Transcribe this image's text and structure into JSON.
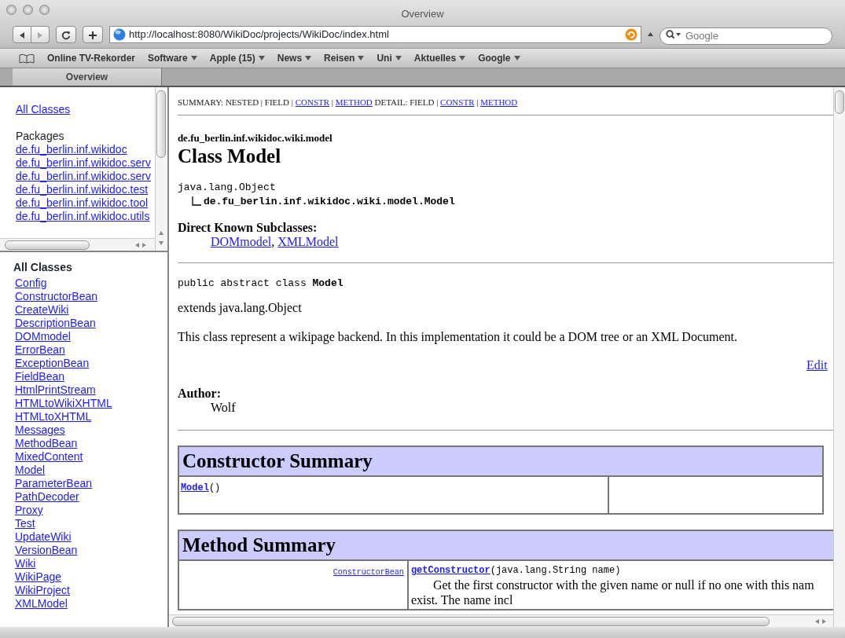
{
  "window": {
    "title": "Overview"
  },
  "toolbar": {
    "url": "http://localhost:8080/WikiDoc/projects/WikiDoc/index.html",
    "search": {
      "placeholder": "Google"
    }
  },
  "bookmarks": [
    {
      "label": "Online TV-Rekorder",
      "has_menu": false
    },
    {
      "label": "Software",
      "has_menu": true
    },
    {
      "label": "Apple (15)",
      "has_menu": true
    },
    {
      "label": "News",
      "has_menu": true
    },
    {
      "label": "Reisen",
      "has_menu": true
    },
    {
      "label": "Uni",
      "has_menu": true
    },
    {
      "label": "Aktuelles",
      "has_menu": true
    },
    {
      "label": "Google",
      "has_menu": true
    }
  ],
  "tabs": [
    {
      "label": "Overview",
      "selected": true
    }
  ],
  "packages_frame": {
    "all_classes_link": "All Classes",
    "heading": "Packages",
    "packages": [
      "de.fu_berlin.inf.wikidoc",
      "de.fu_berlin.inf.wikidoc.serv",
      "de.fu_berlin.inf.wikidoc.serv",
      "de.fu_berlin.inf.wikidoc.test",
      "de.fu_berlin.inf.wikidoc.tool",
      "de.fu_berlin.inf.wikidoc.utils"
    ]
  },
  "classes_frame": {
    "heading": "All Classes",
    "classes": [
      "Config",
      "ConstructorBean",
      "CreateWiki",
      "DescriptionBean",
      "DOMmodel",
      "ErrorBean",
      "ExceptionBean",
      "FieldBean",
      "HtmlPrintStream",
      "HTMLtoWikiXHTML",
      "HTMLtoXHTML",
      "Messages",
      "MethodBean",
      "MixedContent",
      "Model",
      "ParameterBean",
      "PathDecoder",
      "Proxy",
      "Test",
      "UpdateWiki",
      "VersionBean",
      "Wiki",
      "WikiPage",
      "WikiProject",
      "XMLModel"
    ]
  },
  "content": {
    "nav": [
      {
        "text": "SUMMARY: NESTED | FIELD | ",
        "link": false
      },
      {
        "text": "CONSTR",
        "link": true
      },
      {
        "text": " | ",
        "link": false
      },
      {
        "text": "METHOD",
        "link": true
      },
      {
        "text": " DETAIL: FIELD | ",
        "link": false
      },
      {
        "text": "CONSTR",
        "link": true
      },
      {
        "text": " | ",
        "link": false
      },
      {
        "text": "METHOD",
        "link": true
      }
    ],
    "package": "de.fu_berlin.inf.wikidoc.wiki.model",
    "title": "Class Model",
    "hierarchy": [
      "java.lang.Object",
      "de.fu_berlin.inf.wikidoc.wiki.model.Model"
    ],
    "subclasses_heading": "Direct Known Subclasses:",
    "subclasses": [
      "DOMmodel",
      "XMLModel"
    ],
    "subclasses_separator": ",",
    "declaration": "public abstract class **Model**",
    "extends": "extends java.lang.Object",
    "description": "This class represent a wikipage backend. In this implementation it could be a DOM tree or an XML Document.",
    "edit_link": "Edit",
    "author_label": "Author:",
    "author": "Wolf",
    "constructor_summary": {
      "title": "Constructor Summary",
      "rows": [
        {
          "name": "Model",
          "params": "()"
        }
      ]
    },
    "method_summary": {
      "title": "Method Summary",
      "rows": [
        {
          "type": "ConstructorBean",
          "name": "getConstructor",
          "params": "(java.lang.String name)",
          "description": [
            "Get the first constructor with the given name or null if no one with this nam",
            "exist. The name incl"
          ]
        }
      ]
    }
  }
}
